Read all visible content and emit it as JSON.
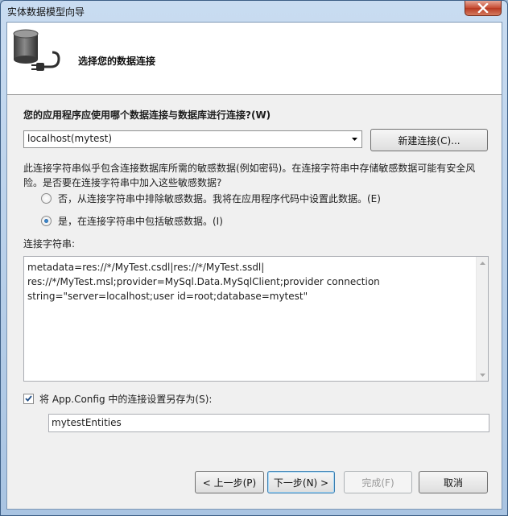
{
  "window": {
    "title": "实体数据模型向导"
  },
  "header": {
    "title": "选择您的数据连接",
    "icon": "database-plug-icon"
  },
  "connection_question": "您的应用程序应使用哪个数据连接与数据库进行连接?(W)",
  "connection_select": {
    "value": "localhost(mytest)"
  },
  "new_connection_label": "新建连接(C)...",
  "sensitive_notice_line1": "此连接字符串似乎包含连接数据库所需的敏感数据(例如密码)。在连接字符串中存储敏感数据可能有安全风",
  "sensitive_notice_line2": "险。是否要在连接字符串中加入这些敏感数据?",
  "radio_options": [
    {
      "label": "否，从连接字符串中排除敏感数据。我将在应用程序代码中设置此数据。(E)",
      "checked": false
    },
    {
      "label": "是，在连接字符串中包括敏感数据。(I)",
      "checked": true
    }
  ],
  "connection_string_label": "连接字符串:",
  "connection_string": "metadata=res://*/MyTest.csdl|res://*/MyTest.ssdl|\nres://*/MyTest.msl;provider=MySql.Data.MySqlClient;provider connection\nstring=\"server=localhost;user id=root;database=mytest\"",
  "save_config": {
    "checked": true,
    "label": "将 App.Config 中的连接设置另存为(S):",
    "value": "mytestEntities"
  },
  "buttons": {
    "back": "< 上一步(P)",
    "next": "下一步(N) >",
    "finish": "完成(F)",
    "cancel": "取消"
  }
}
